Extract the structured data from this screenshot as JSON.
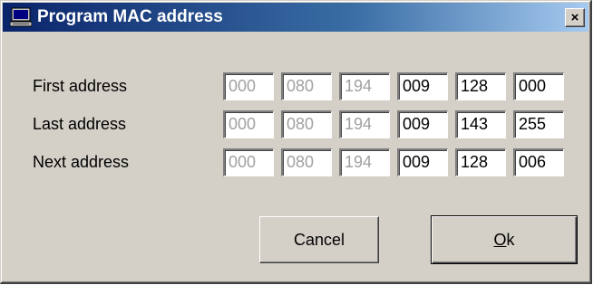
{
  "window": {
    "title": "Program MAC address",
    "close_glyph": "×",
    "icon": "computer-icon",
    "title_gradient": [
      "#0a246a",
      "#a6caf0"
    ]
  },
  "rows": [
    {
      "label": "First address",
      "octets": [
        "000",
        "080",
        "194",
        "009",
        "128",
        "000"
      ]
    },
    {
      "label": "Last address",
      "octets": [
        "000",
        "080",
        "194",
        "009",
        "143",
        "255"
      ]
    },
    {
      "label": "Next address",
      "octets": [
        "000",
        "080",
        "194",
        "009",
        "128",
        "006"
      ]
    }
  ],
  "buttons": {
    "cancel_label": "Cancel",
    "ok_mnemonic": "O",
    "ok_rest": "k"
  },
  "colors": {
    "dialog_bg": "#d4d0c8",
    "disabled_text": "#a0a0a0"
  }
}
